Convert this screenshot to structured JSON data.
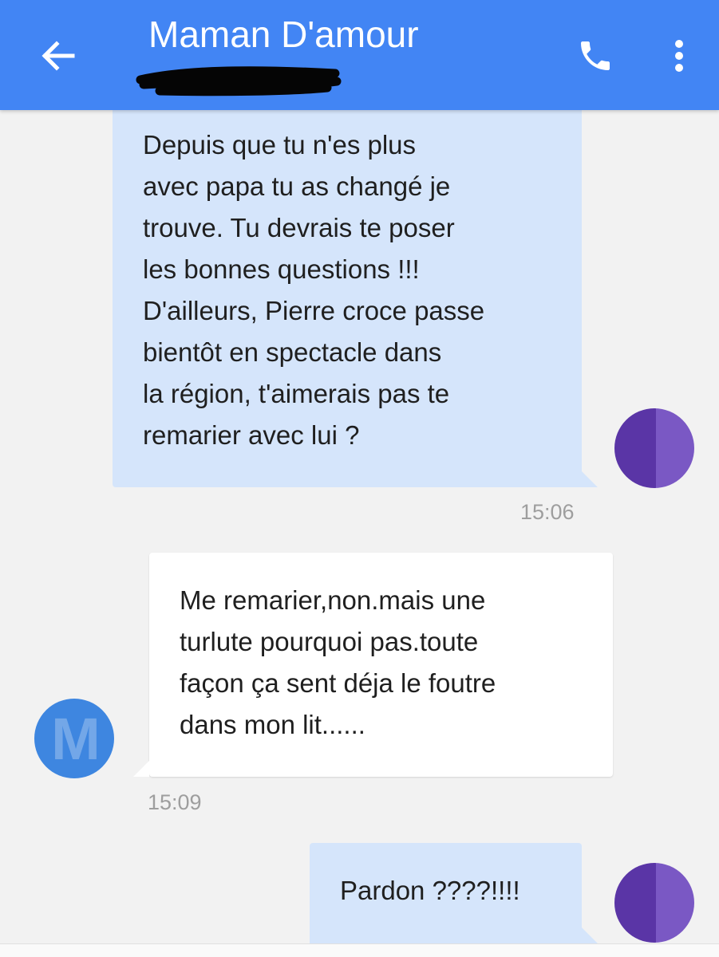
{
  "header": {
    "title": "Maman D'amour",
    "background_color": "#4285f4",
    "back_icon": "arrow-left-icon",
    "call_icon": "phone-icon",
    "menu_icon": "more-vert-icon",
    "subtitle_redacted": true
  },
  "conversation": {
    "messages": [
      {
        "direction": "sent",
        "lines": [
          "Depuis que tu n'es plus",
          "avec papa tu as changé je",
          "trouve. Tu devrais te poser",
          "les bonnes questions !!!",
          "D'ailleurs, Pierre croce passe",
          "bientôt en spectacle dans",
          "la région, t'aimerais pas te",
          "remarier avec lui ?"
        ],
        "time": "15:06"
      },
      {
        "direction": "received",
        "lines": [
          "Me remarier,non.mais une",
          "turlute pourquoi pas.toute",
          "façon ça sent déja le foutre",
          "dans mon lit......"
        ],
        "time": "15:09",
        "avatar_letter": "M"
      },
      {
        "direction": "sent",
        "lines": [
          "Pardon ????!!!!"
        ]
      }
    ]
  },
  "colors": {
    "sent_bubble": "#d5e5fb",
    "received_bubble": "#ffffff",
    "my_avatar": "#5a35a6",
    "contact_avatar": "#3e86e0"
  }
}
